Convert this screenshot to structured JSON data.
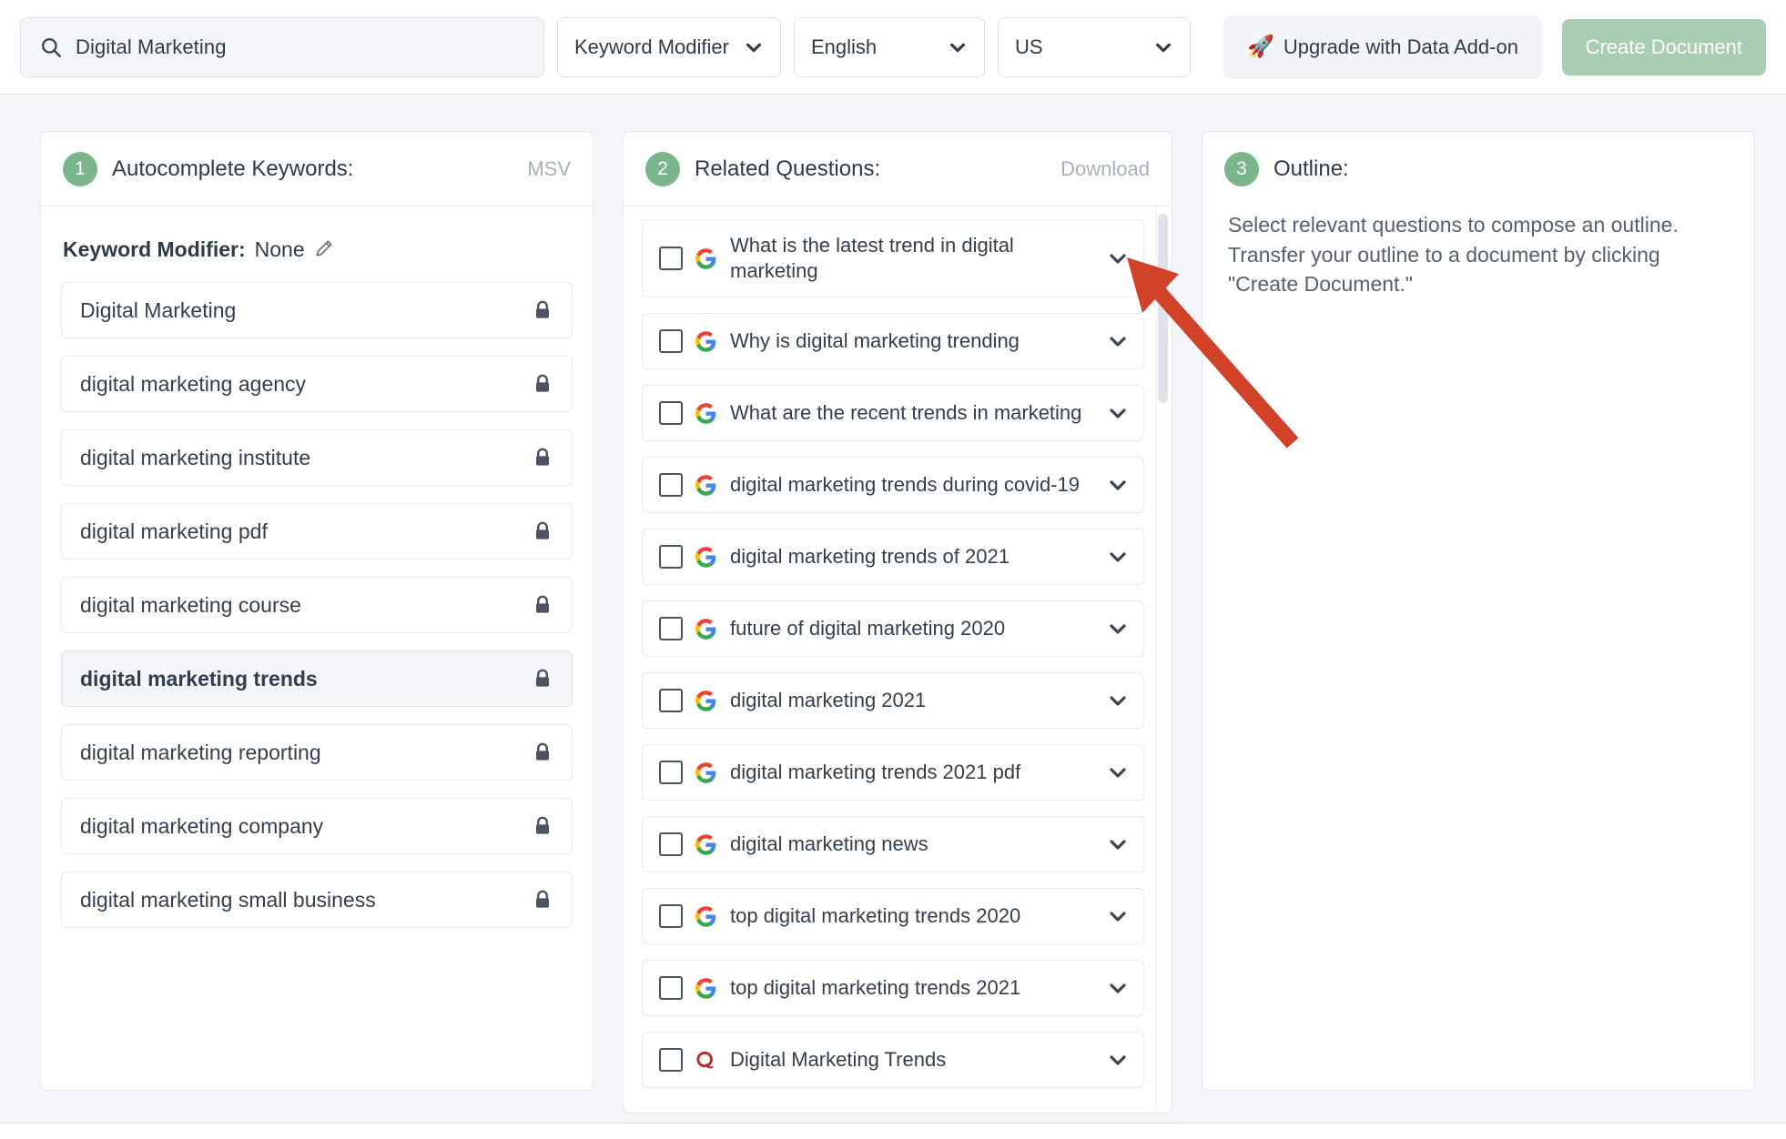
{
  "toolbar": {
    "search": {
      "icon": "search-icon",
      "value": "Digital Marketing",
      "placeholder": "Search keyword"
    },
    "keyword_modifier_select": {
      "label": "Keyword Modifier",
      "icon": "chevron-down-icon"
    },
    "language_select": {
      "label": "English",
      "icon": "chevron-down-icon"
    },
    "country_select": {
      "label": "US",
      "icon": "chevron-down-icon"
    },
    "upgrade_button": {
      "icon": "rocket-icon",
      "glyph": "🚀",
      "label": "Upgrade with Data Add-on"
    },
    "create_document_button": {
      "label": "Create Document",
      "disabled_color": "#a8cdb2"
    }
  },
  "panels": {
    "keywords": {
      "step": "1",
      "title": "Autocomplete Keywords:",
      "action_label": "MSV",
      "modifier_prefix": "Keyword Modifier:",
      "modifier_value": "None",
      "edit_icon": "pencil-icon",
      "lock_icon": "lock-icon",
      "rows": [
        {
          "text": "Digital Marketing",
          "locked": true,
          "active": false
        },
        {
          "text": "digital marketing agency",
          "locked": true,
          "active": false
        },
        {
          "text": "digital marketing institute",
          "locked": true,
          "active": false
        },
        {
          "text": "digital marketing pdf",
          "locked": true,
          "active": false
        },
        {
          "text": "digital marketing course",
          "locked": true,
          "active": false
        },
        {
          "text": "digital marketing trends",
          "locked": true,
          "active": true
        },
        {
          "text": "digital marketing reporting",
          "locked": true,
          "active": false
        },
        {
          "text": "digital marketing company",
          "locked": true,
          "active": false
        },
        {
          "text": "digital marketing small business",
          "locked": true,
          "active": false
        }
      ]
    },
    "questions": {
      "step": "2",
      "title": "Related Questions:",
      "action_label": "Download",
      "checkbox_icon": "checkbox-unchecked-icon",
      "chevron_icon": "chevron-down-icon",
      "rows": [
        {
          "text": "What is the latest trend in digital marketing",
          "source": "google-icon",
          "checked": false,
          "two_line": true
        },
        {
          "text": "Why is digital marketing trending",
          "source": "google-icon",
          "checked": false,
          "two_line": false
        },
        {
          "text": "What are the recent trends in marketing",
          "source": "google-icon",
          "checked": false,
          "two_line": false
        },
        {
          "text": "digital marketing trends during covid-19",
          "source": "google-icon",
          "checked": false,
          "two_line": false
        },
        {
          "text": "digital marketing trends of 2021",
          "source": "google-icon",
          "checked": false,
          "two_line": false
        },
        {
          "text": "future of digital marketing 2020",
          "source": "google-icon",
          "checked": false,
          "two_line": false
        },
        {
          "text": "digital marketing 2021",
          "source": "google-icon",
          "checked": false,
          "two_line": false
        },
        {
          "text": "digital marketing trends 2021 pdf",
          "source": "google-icon",
          "checked": false,
          "two_line": false
        },
        {
          "text": "digital marketing news",
          "source": "google-icon",
          "checked": false,
          "two_line": false
        },
        {
          "text": "top digital marketing trends 2020",
          "source": "google-icon",
          "checked": false,
          "two_line": false
        },
        {
          "text": "top digital marketing trends 2021",
          "source": "google-icon",
          "checked": false,
          "two_line": false
        },
        {
          "text": "Digital Marketing Trends",
          "source": "quora-icon",
          "checked": false,
          "two_line": false
        }
      ]
    },
    "outline": {
      "step": "3",
      "title": "Outline:",
      "help_text": "Select relevant questions to compose an outline. Transfer your outline to a document by clicking \"Create Document.\""
    }
  },
  "annotation": {
    "type": "arrow",
    "color": "#d14228",
    "points_to": "first-question-chevron"
  },
  "colors": {
    "accent_green": "#7ab58c",
    "disabled_green": "#a8cdb2",
    "workspace_bg": "#f3f5f8",
    "text": "#343f4d",
    "muted": "#a9b0ba",
    "annotation_red": "#d14228"
  }
}
